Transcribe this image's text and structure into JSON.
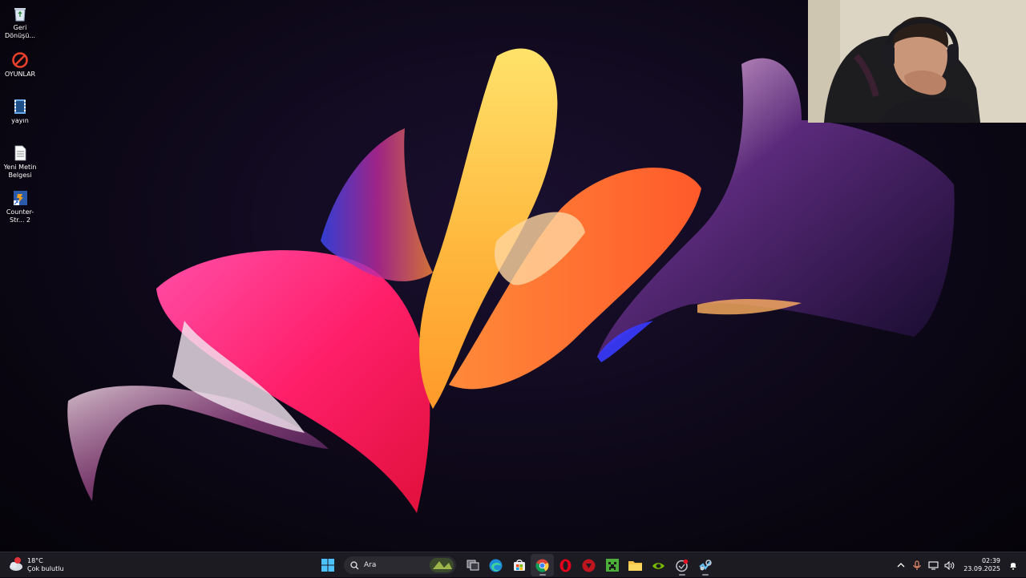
{
  "desktop": {
    "icons": [
      {
        "label": "Geri Dönüşü...",
        "icon": "recycle-bin-icon"
      },
      {
        "label": "OYUNLAR",
        "icon": "forbidden-folder-icon"
      },
      {
        "label": "yayın",
        "icon": "video-file-icon"
      },
      {
        "label": "Yeni Metin Belgesi",
        "icon": "text-file-icon"
      },
      {
        "label": "Counter-Str... 2",
        "icon": "game-shortcut-icon"
      }
    ]
  },
  "weather": {
    "temp": "18°C",
    "desc": "Çok bulutlu"
  },
  "taskbar": {
    "search_text": "Ara",
    "apps": [
      "start-icon",
      "search-icon",
      "task-view-icon",
      "edge-icon",
      "store-icon",
      "chrome-icon",
      "opera-icon",
      "red-app-icon",
      "minecraft-icon",
      "file-explorer-icon",
      "nvidia-icon",
      "app-icon",
      "steam-icon"
    ]
  },
  "clock": {
    "time": "02:39",
    "date": "23.09.2025"
  },
  "colors": {
    "taskbar": "#1c1b22",
    "accent": "#4cc2ff"
  }
}
